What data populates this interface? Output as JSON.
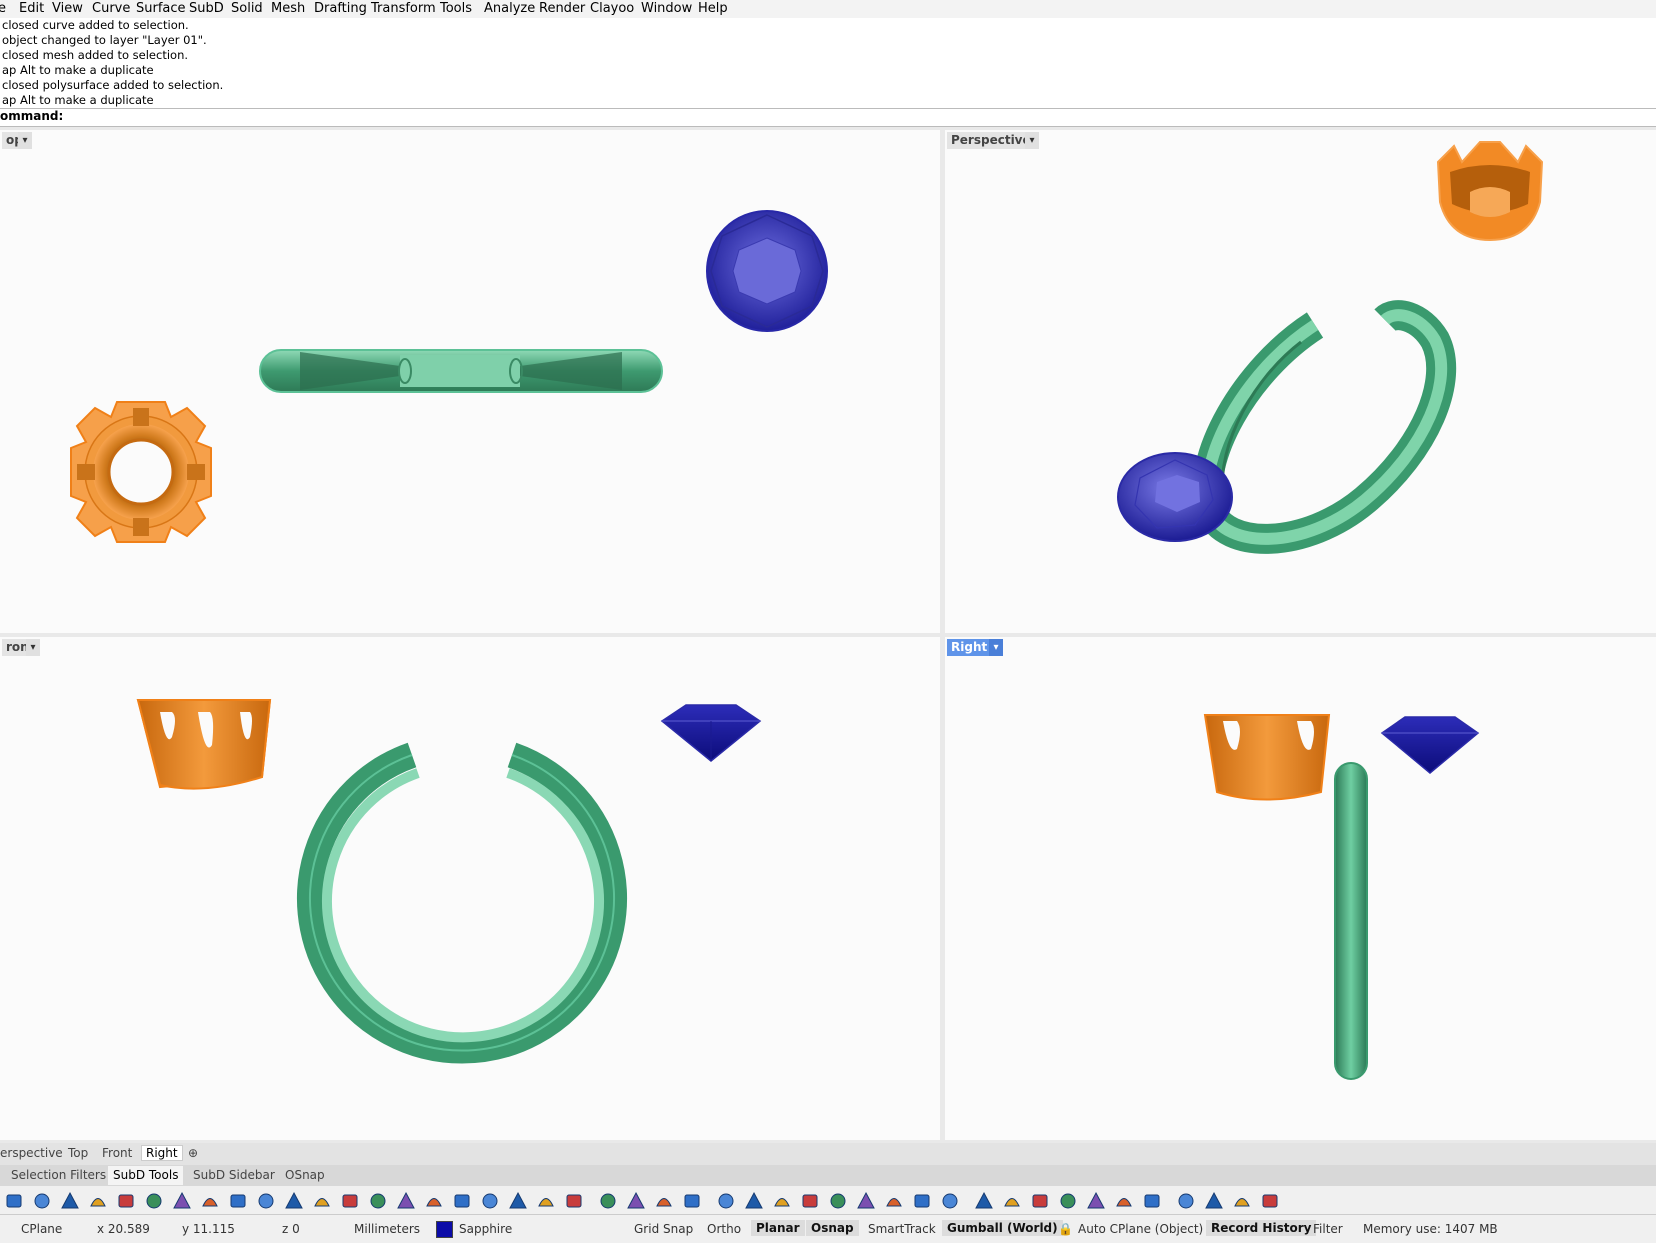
{
  "menu": [
    "e",
    "Edit",
    "View",
    "Curve",
    "Surface",
    "SubD",
    "Solid",
    "Mesh",
    "Drafting",
    "Transform",
    "Tools",
    "Analyze",
    "Render",
    "Clayoo",
    "Window",
    "Help"
  ],
  "history": [
    "closed curve added to selection.",
    "object changed to layer \"Layer 01\".",
    "closed mesh added to selection.",
    "ap Alt to make a duplicate",
    "closed polysurface added to selection.",
    "ap Alt to make a duplicate"
  ],
  "command": {
    "prompt": "ommand:"
  },
  "viewports": {
    "top": {
      "label": "op",
      "active": false
    },
    "perspective": {
      "label": "Perspective",
      "active": false
    },
    "front": {
      "label": "ront",
      "active": false
    },
    "right": {
      "label": "Right",
      "active": true
    }
  },
  "viewport_tabs": [
    "erspective",
    "Top",
    "Front",
    "Right"
  ],
  "panel_tabs": [
    "Selection Filters",
    "SubD Tools",
    "SubD Sidebar",
    "OSnap"
  ],
  "toolbar_icons": [
    "subd-plane-icon",
    "subd-box-icon",
    "subd-cube-icon",
    "subd-cylinder-icon",
    "subd-pipe-icon",
    "subd-quadball-icon",
    "subd-cone-icon",
    "subd-sphere-icon",
    "subd-torus-icon",
    "subd-patch-icon",
    "insert-edges-icon",
    "subd-loft-icon",
    "subd-sweep-icon",
    "subd-fill-icon",
    "subd-bridge-icon",
    "subd-crease-icon",
    "subd-extrude-icon",
    "subd-bevel-icon",
    "subd-weld-icon",
    "subd-star-icon",
    "subd-ellipse-icon",
    "subd-paint-icon",
    "subd-join-icon",
    "subd-unweld-icon",
    "subd-mesh-icon",
    "subd-smooth-icon",
    "subd-slide-icon",
    "subd-stitch-icon",
    "subd-network-icon",
    "subd-convert-icon",
    "subd-append-icon",
    "subd-select-icon",
    "subd-loop-icon",
    "subd-ring-icon",
    "subd-boundary-icon",
    "subd-tips-icon",
    "subd-pencil-icon",
    "subd-list-icon",
    "subd-frame-icon",
    "subd-mirror-icon",
    "subd-reflect-icon",
    "subd-symmetry-icon",
    "subd-remove-icon",
    "subd-filter-icon",
    "subd-heart-icon"
  ],
  "status": {
    "cplane": "CPlane",
    "x": "x 20.589",
    "y": "y 11.115",
    "z": "z 0",
    "units": "Millimeters",
    "layer": "Sapphire",
    "layer_color": "#0c0ca8",
    "grid_snap": "Grid Snap",
    "ortho": "Ortho",
    "planar": "Planar",
    "osnap": "Osnap",
    "smarttrack": "SmartTrack",
    "gumball": "Gumball (World)",
    "auto_cplane": "Auto CPlane (Object)",
    "record_history": "Record History",
    "filter": "Filter",
    "memory": "Memory use: 1407 MB"
  },
  "colors": {
    "ring": "#5cc196",
    "crown": "#f28a25",
    "gem": "#2222aa",
    "active_viewport": "#5f94e9"
  }
}
